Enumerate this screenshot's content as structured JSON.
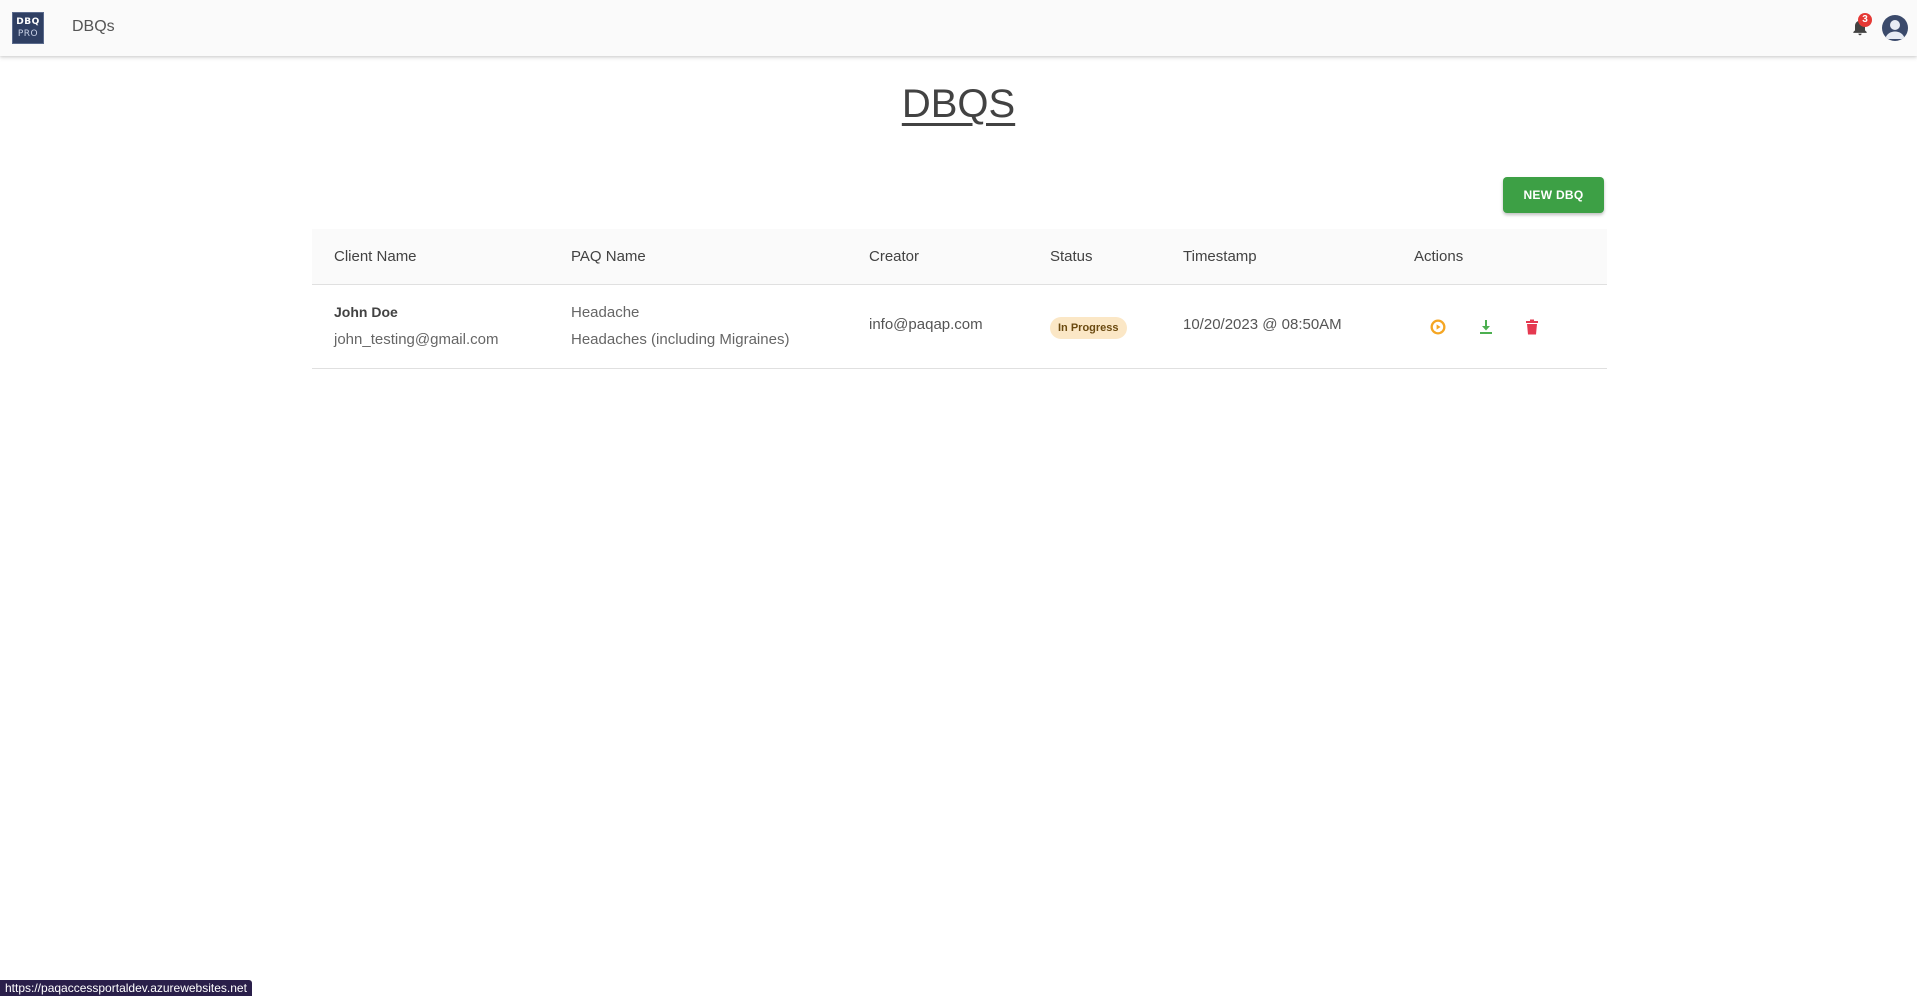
{
  "app": {
    "logo_line1": "DBQ",
    "logo_line2": "PRO",
    "title": "DBQs",
    "notification_count": "3"
  },
  "page": {
    "heading": "DBQS",
    "new_button_label": "NEW DBQ"
  },
  "table": {
    "columns": [
      "Client Name",
      "PAQ Name",
      "Creator",
      "Status",
      "Timestamp",
      "Actions"
    ],
    "rows": [
      {
        "client_name": "John Doe",
        "client_email": "john_testing@gmail.com",
        "paq_name": "Headache",
        "paq_subtitle": "Headaches (including Migraines)",
        "creator": "info@paqap.com",
        "status": "In Progress",
        "timestamp": "10/20/2023 @ 08:50AM",
        "actions": [
          "play-icon",
          "download-icon",
          "delete-icon"
        ]
      }
    ]
  },
  "status_bar": {
    "url": "https://paqaccessportaldev.azurewebsites.net"
  },
  "colors": {
    "primary_button": "#3da045",
    "status_badge_bg": "#fbe7c6",
    "play_icon": "#f5a623",
    "download_icon": "#4caf50",
    "delete_icon": "#e53950",
    "notification_badge": "#e53935"
  }
}
